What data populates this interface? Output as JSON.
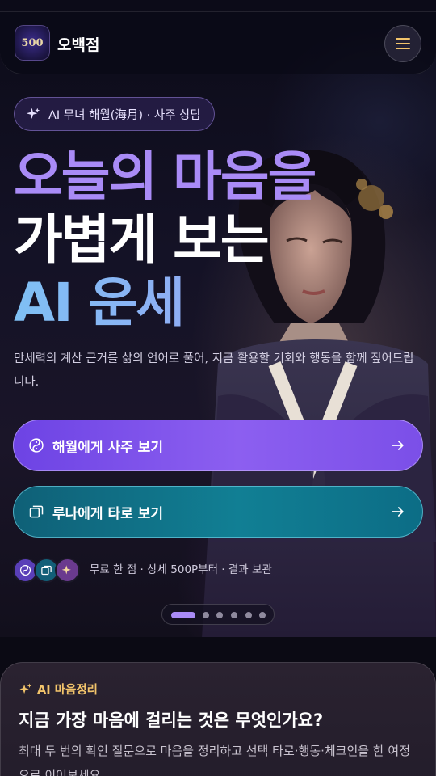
{
  "header": {
    "logo_text": "500",
    "brand": "오백점",
    "menu_icon": "hamburger-icon"
  },
  "hero": {
    "badge": "AI 무녀 해월(海月) · 사주 상담",
    "headline_line1": "오늘의 마음을",
    "headline_line2": "가볍게 보는",
    "headline_line3": "AI 운세",
    "description": "만세력의 계산 근거를 삶의 언어로 풀어, 지금 활용할 기회와 행동을 함께 짚어드립니다.",
    "cta_saju": "해월에게 사주 보기",
    "cta_tarot": "루나에게 타로 보기",
    "meta": "무료 한 점 · 상세 500P부터 · 결과 보관",
    "slides": {
      "count": 6,
      "active_index": 0
    }
  },
  "card": {
    "tag": "AI 마음정리",
    "title": "지금 가장 마음에 걸리는 것은 무엇인가요?",
    "description": "최대 두 번의 확인 질문으로 마음을 정리하고 선택 타로·행동·체크인을 한 여정으로 이어보세요."
  },
  "colors": {
    "accent_purple": "#a98bf6",
    "accent_gold": "#f2c46b",
    "accent_teal": "#117f94"
  }
}
